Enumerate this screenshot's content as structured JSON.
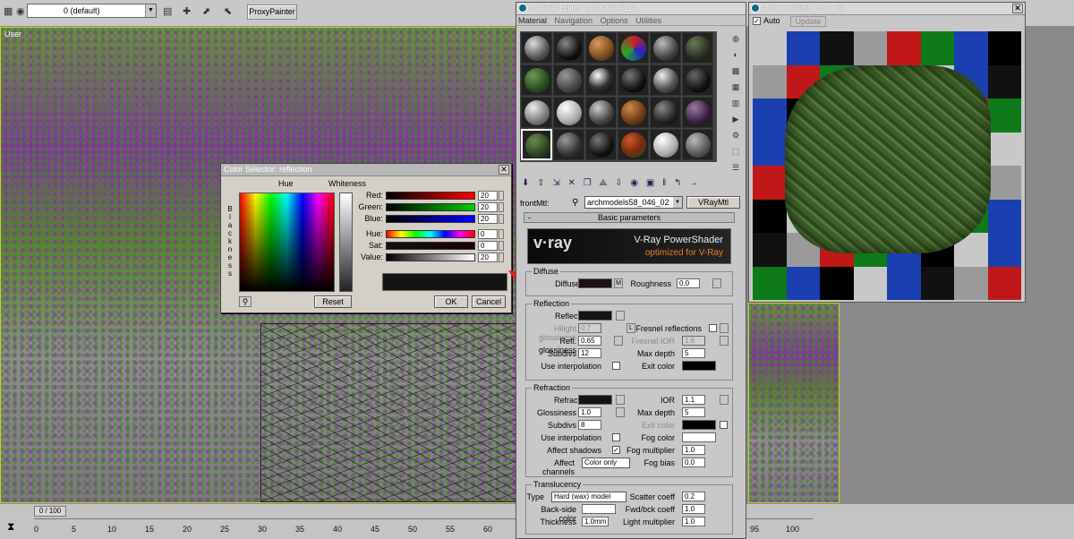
{
  "toolbar": {
    "layer": "0 (default)",
    "proxy_painter": "ProxyPainter"
  },
  "viewport": {
    "label": "User"
  },
  "timeline": {
    "frame": "0 / 100",
    "ticks": [
      "0",
      "5",
      "10",
      "15",
      "20",
      "25",
      "30",
      "35",
      "40",
      "45",
      "50",
      "55",
      "60",
      "95",
      "100"
    ]
  },
  "color_selector": {
    "title": "Color Selector: reflection",
    "hue_label": "Hue",
    "whiteness_label": "Whiteness",
    "blackness_label": "Blackness",
    "rows": [
      {
        "label": "Red:",
        "value": "20"
      },
      {
        "label": "Green:",
        "value": "20"
      },
      {
        "label": "Blue:",
        "value": "20"
      },
      {
        "label": "Hue:",
        "value": "0"
      },
      {
        "label": "Sat:",
        "value": "0"
      },
      {
        "label": "Value:",
        "value": "20"
      }
    ],
    "reset": "Reset",
    "ok": "OK",
    "cancel": "Cancel",
    "swatch_color": "#141414"
  },
  "material_editor": {
    "title": "Material Editor - Material #11a",
    "menu": [
      "Material",
      "Navigation",
      "Options",
      "Utilities"
    ],
    "mtl_label": "frontMtl:",
    "mtl_name": "archmodels58_046_02",
    "mtl_type": "VRayMtl",
    "rollout": "Basic parameters",
    "vray_logo": "v·ray",
    "vray_title": "V-Ray PowerShader",
    "vray_subtitle": "optimized for V-Ray",
    "diffuse": {
      "group": "Diffuse",
      "diffuse": "Diffuse",
      "m": "M",
      "roughness": "Roughness",
      "roughness_val": "0.0"
    },
    "reflection": {
      "group": "Reflection",
      "reflect": "Reflect",
      "hilight": "Hilight glossiness",
      "hilight_val": "0.7",
      "l": "L",
      "fresnel": "Fresnel reflections",
      "refl_gloss": "Refl. glossiness",
      "refl_gloss_val": "0.65",
      "fresnel_ior": "Fresnel IOR",
      "fresnel_ior_val": "1.6",
      "subdivs": "Subdivs",
      "subdivs_val": "12",
      "max_depth": "Max depth",
      "max_depth_val": "5",
      "use_interp": "Use interpolation",
      "exit_color": "Exit color"
    },
    "refraction": {
      "group": "Refraction",
      "refract": "Refract",
      "ior": "IOR",
      "ior_val": "1.1",
      "glossiness": "Glossiness",
      "glossiness_val": "1.0",
      "max_depth": "Max depth",
      "max_depth_val": "5",
      "subdivs": "Subdivs",
      "subdivs_val": "8",
      "exit_color": "Exit color",
      "use_interp": "Use interpolation",
      "fog_color": "Fog color",
      "affect_shadows": "Affect shadows",
      "fog_mult": "Fog multiplier",
      "fog_mult_val": "1.0",
      "affect_channels": "Affect channels",
      "affect_channels_val": "Color only",
      "fog_bias": "Fog bias",
      "fog_bias_val": "0.0"
    },
    "translucency": {
      "group": "Translucency",
      "type": "Type",
      "type_val": "Hard (wax) model",
      "scatter": "Scatter coeff",
      "scatter_val": "0.2",
      "backside": "Back-side color",
      "fwd": "Fwd/bck coeff",
      "fwd_val": "1.0",
      "thickness": "Thickness",
      "thickness_val": "1.0mm",
      "light_mult": "Light multiplier",
      "light_mult_val": "1.0"
    }
  },
  "preview": {
    "title": "archmodels58_046_02",
    "auto": "Auto",
    "update": "Update"
  }
}
